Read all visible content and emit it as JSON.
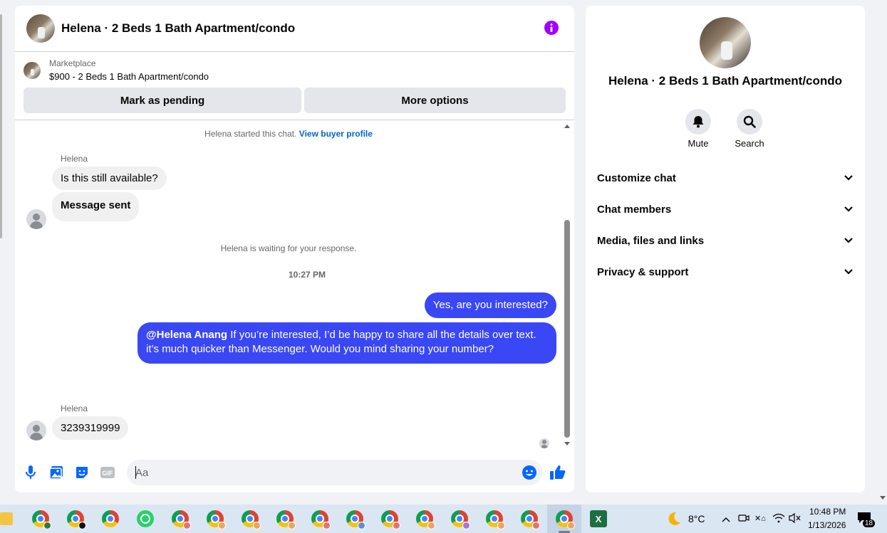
{
  "chat": {
    "title": "Helena · 2 Beds 1 Bath Apartment/condo",
    "marketplace_label": "Marketplace",
    "listing": "$900 - 2 Beds 1 Bath Apartment/condo",
    "mark_pending_label": "Mark as pending",
    "more_options_label": "More options",
    "started_note": "Helena started this chat.",
    "view_profile_link": "View buyer profile",
    "messages": [
      {
        "sender": "Helena",
        "text": "Is this still available?"
      },
      {
        "text": "Message sent"
      },
      {
        "text": "Yes, are you interested?"
      },
      {
        "mention": "@Helena Anang",
        "text": " If you’re interested, I’d be happy to share all the details over text. it’s much quicker than Messenger. Would you mind sharing your number?"
      },
      {
        "sender": "Helena",
        "text": "3239319999"
      }
    ],
    "waiting_note": "Helena is waiting for your response.",
    "timestamp": "10:27 PM",
    "input_placeholder": "Aa",
    "accent_color": "#3a47f5"
  },
  "info": {
    "title": "Helena · 2 Beds 1 Bath Apartment/condo",
    "mute_label": "Mute",
    "search_label": "Search",
    "sections": [
      "Customize chat",
      "Chat members",
      "Media, files and links",
      "Privacy & support"
    ]
  },
  "taskbar": {
    "weather": "8°C",
    "time": "10:48 PM",
    "date": "1/13/2026",
    "notifications": "18",
    "excel_label": "X"
  }
}
